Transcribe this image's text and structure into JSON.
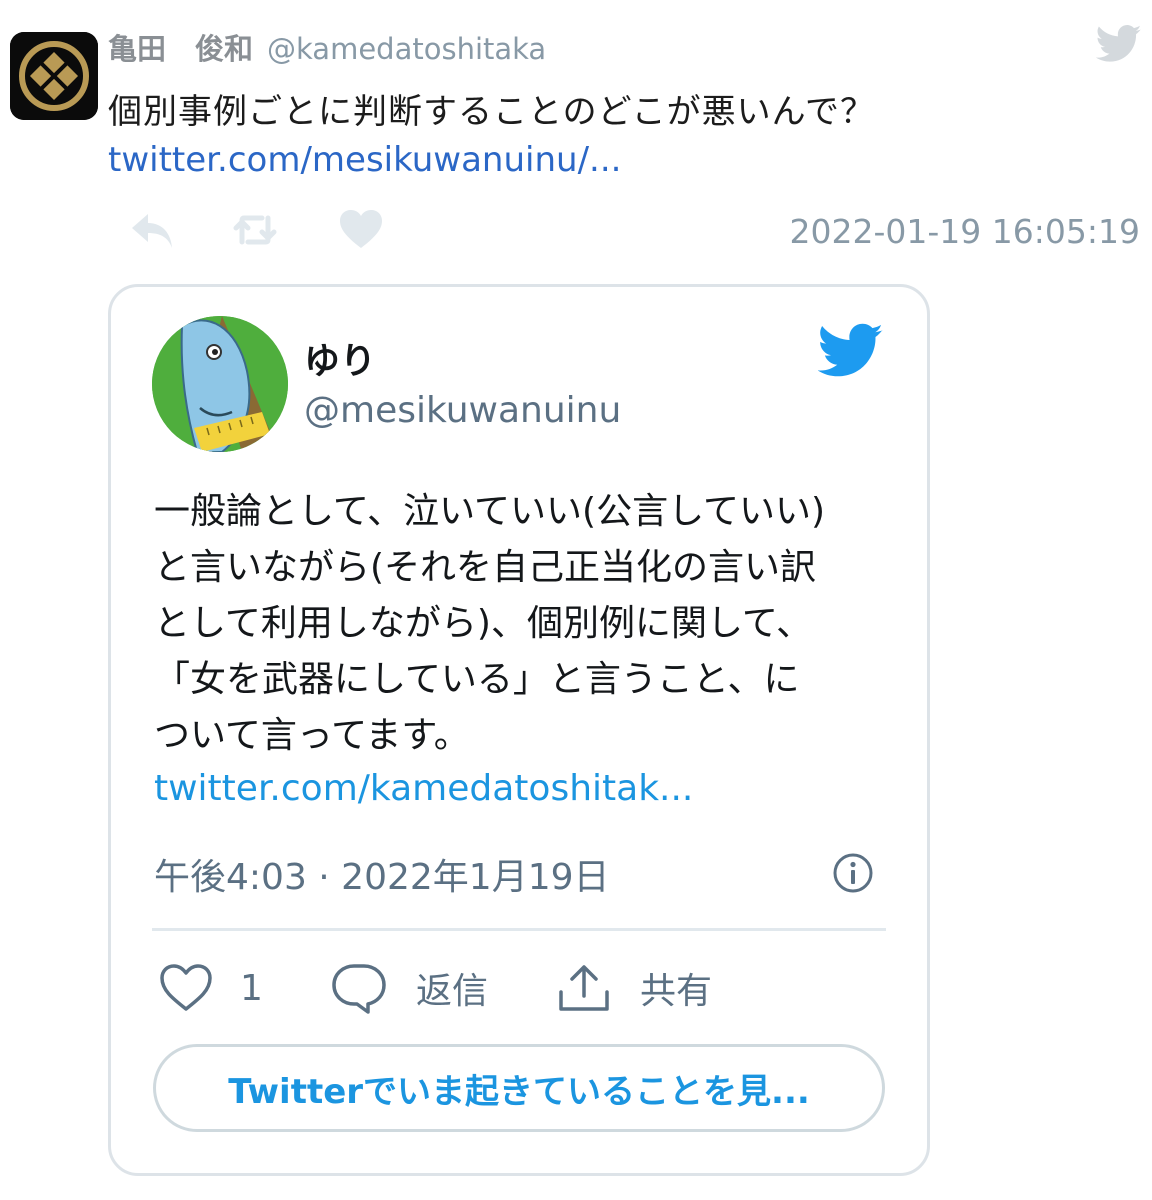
{
  "tweet": {
    "author_name": "亀田　俊和",
    "author_handle": "@kamedatoshitaka",
    "text": "個別事例ごとに判断することのどこが悪いんで？",
    "link": "twitter.com/mesikuwanuinu/...",
    "timestamp": "2022-01-19 16:05:19",
    "actions": [
      "reply-icon",
      "retweet-icon",
      "like-icon"
    ]
  },
  "embed": {
    "name": "ゆり",
    "handle": "@mesikuwanuinu",
    "body_lines": [
      "一般論として、泣いていい(公言していい)",
      "と言いながら(それを自己正当化の言い訳",
      "として利用しながら)、個別例に関して、",
      "「女を武器にしている」と言うこと、に",
      "ついて言ってます。"
    ],
    "link": "twitter.com/kamedatoshitak...",
    "date": "午後4:03 · 2022年1月19日",
    "like_count": "1",
    "reply_label": "返信",
    "share_label": "共有",
    "cta_label": "Twitterでいま起きていることを見..."
  },
  "colors": {
    "twitter_blue": "#1b95e0",
    "link_blue": "#2b67c6",
    "muted_gray": "#8899a6",
    "border": "#dde3e8"
  }
}
